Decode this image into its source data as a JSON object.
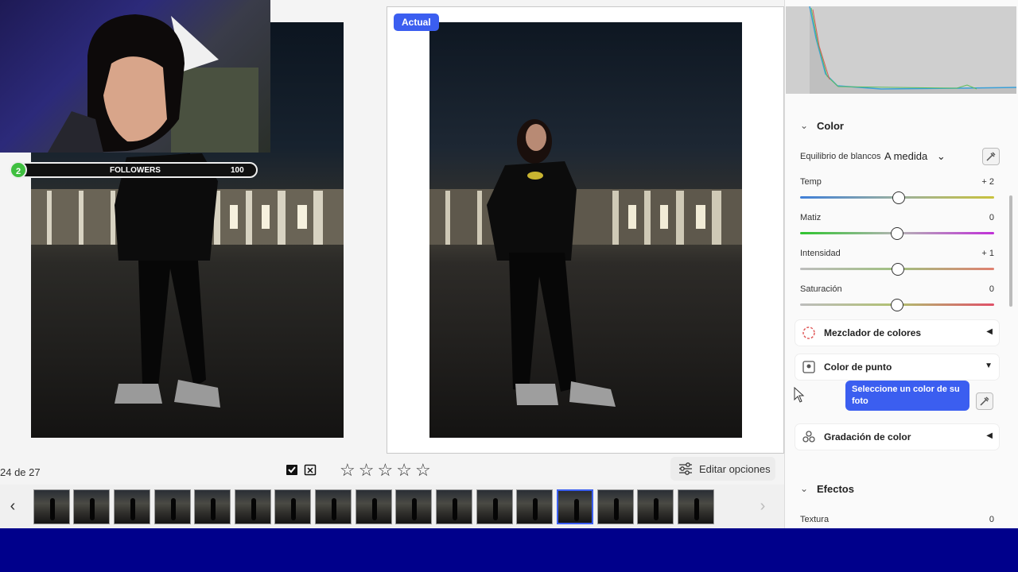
{
  "badge": {
    "current": "Actual"
  },
  "stream_overlay": {
    "followers_count": "2",
    "followers_label": "FOLLOWERS",
    "followers_goal": "100"
  },
  "toolbar": {
    "photo_counter": "24 de 27",
    "edit_options_label": "Editar opciones",
    "rating_stars": 0
  },
  "panel": {
    "color_section": {
      "title": "Color",
      "white_balance_label": "Equilibrio de blancos",
      "white_balance_value": "A medida",
      "sliders": [
        {
          "label": "Temp",
          "value": "+ 2"
        },
        {
          "label": "Matiz",
          "value": "0"
        },
        {
          "label": "Intensidad",
          "value": "+ 1"
        },
        {
          "label": "Saturación",
          "value": "0"
        }
      ],
      "subsections": [
        {
          "label": "Mezclador de colores",
          "icon": "color-mixer-icon",
          "state": "collapsed"
        },
        {
          "label": "Color de punto",
          "icon": "point-color-icon",
          "state": "expanded"
        },
        {
          "label": "Gradación de color",
          "icon": "color-grading-icon",
          "state": "collapsed"
        }
      ],
      "point_color_hint": "Seleccione un color de su foto"
    },
    "effects_section": {
      "title": "Efectos",
      "sliders": [
        {
          "label": "Textura",
          "value": "0"
        }
      ]
    }
  },
  "colors": {
    "accent": "#3b5ef0",
    "bottom_band": "#00008b"
  }
}
